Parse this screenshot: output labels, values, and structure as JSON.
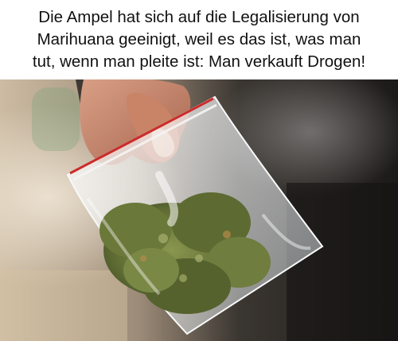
{
  "caption": {
    "lines": [
      "Die Ampel hat sich auf die Legalisierung von",
      "Marihuana geeinigt, weil es das ist, was man",
      "tut, wenn man pleite ist: Man verkauft Drogen!"
    ]
  },
  "photo": {
    "subject": "hand-holding-bag-of-cannabis",
    "colors": {
      "background_left": "#c9b8a0",
      "background_right": "#1f1d1c",
      "skin": "#c98d72",
      "bag": "#eef2f4",
      "bag_seal": "#cc2b2b",
      "cannabis": "#6f7d3f"
    }
  }
}
